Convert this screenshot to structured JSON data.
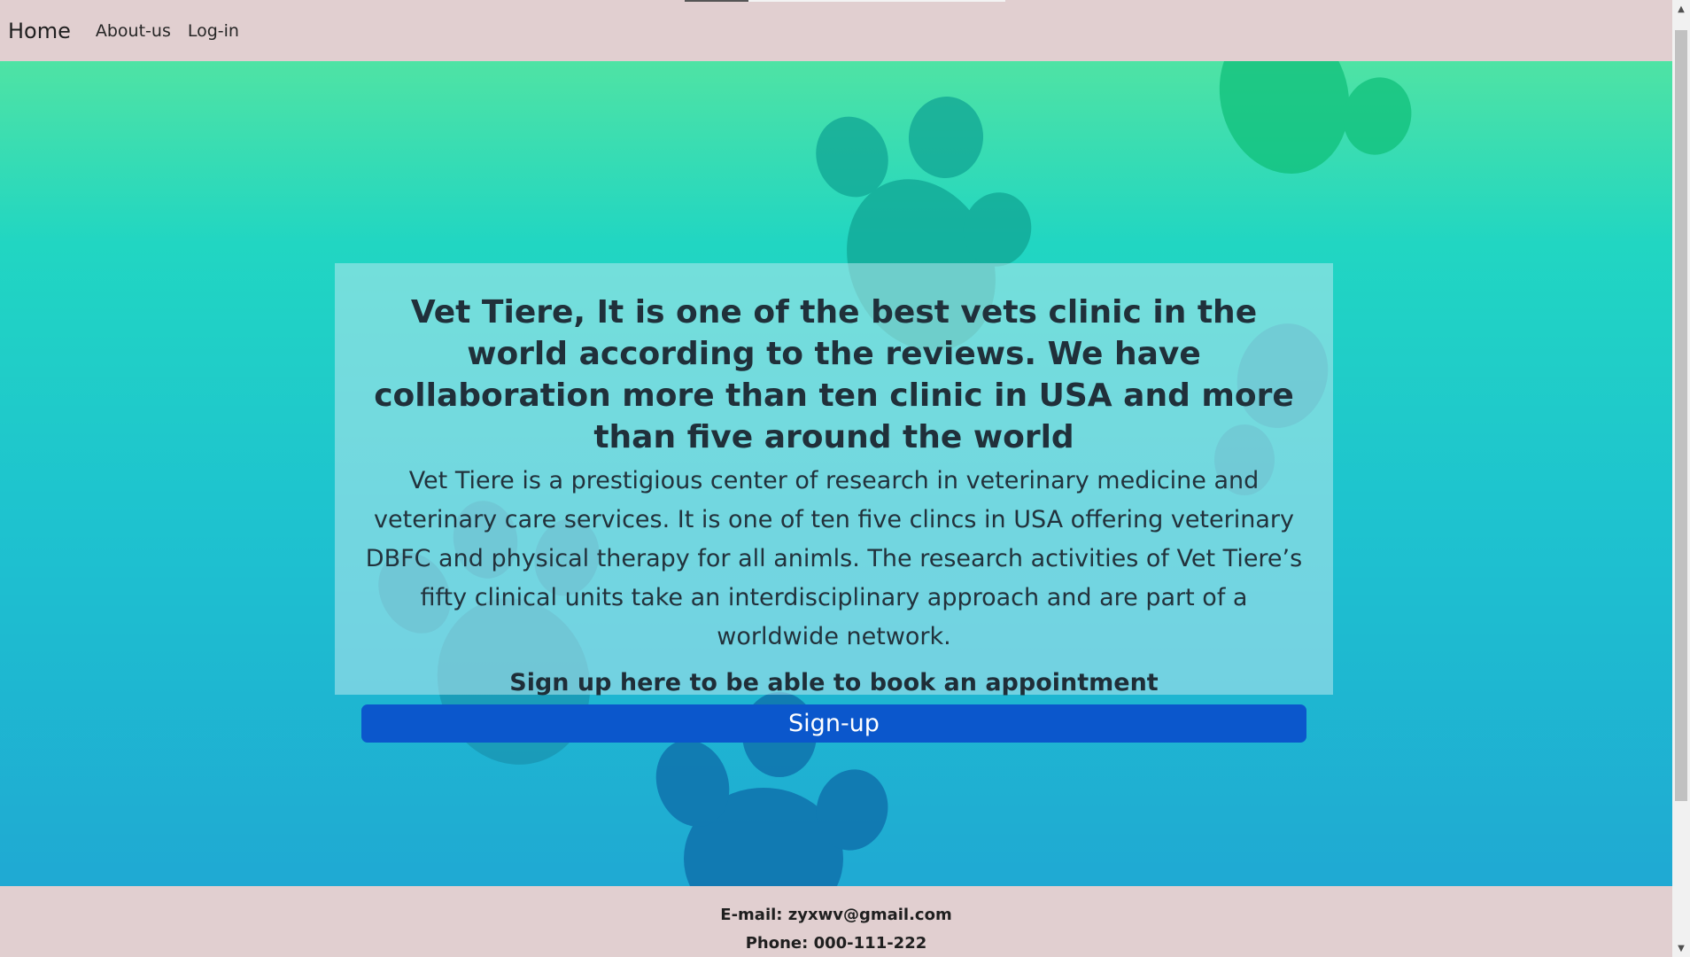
{
  "nav": {
    "brand": "Home",
    "links": [
      {
        "label": "About-us"
      },
      {
        "label": "Log-in"
      }
    ]
  },
  "hero": {
    "title": "Vet Tiere, It is one of the best vets clinic in the world according to the reviews. We have collaboration more than ten clinic in USA and more than five around the world",
    "body": "Vet Tiere is a prestigious center of research in veterinary medicine and veterinary care services. It is one of ten five clincs in USA offering veterinary DBFC and physical therapy for all animls. The research activities of Vet Tiere’s fifty clinical units take an interdisciplinary approach and are part of a worldwide network.",
    "cta_text": "Sign up here to be able to book an appointment",
    "signup_label": "Sign-up"
  },
  "footer": {
    "email": "E-mail: zyxwv@gmail.com",
    "phone": "Phone: 000-111-222"
  },
  "colors": {
    "nav_bg": "#e1cfd0",
    "button": "#0b57cc",
    "gradient_top": "#4fe3a4",
    "gradient_bottom": "#1fa9d3"
  }
}
